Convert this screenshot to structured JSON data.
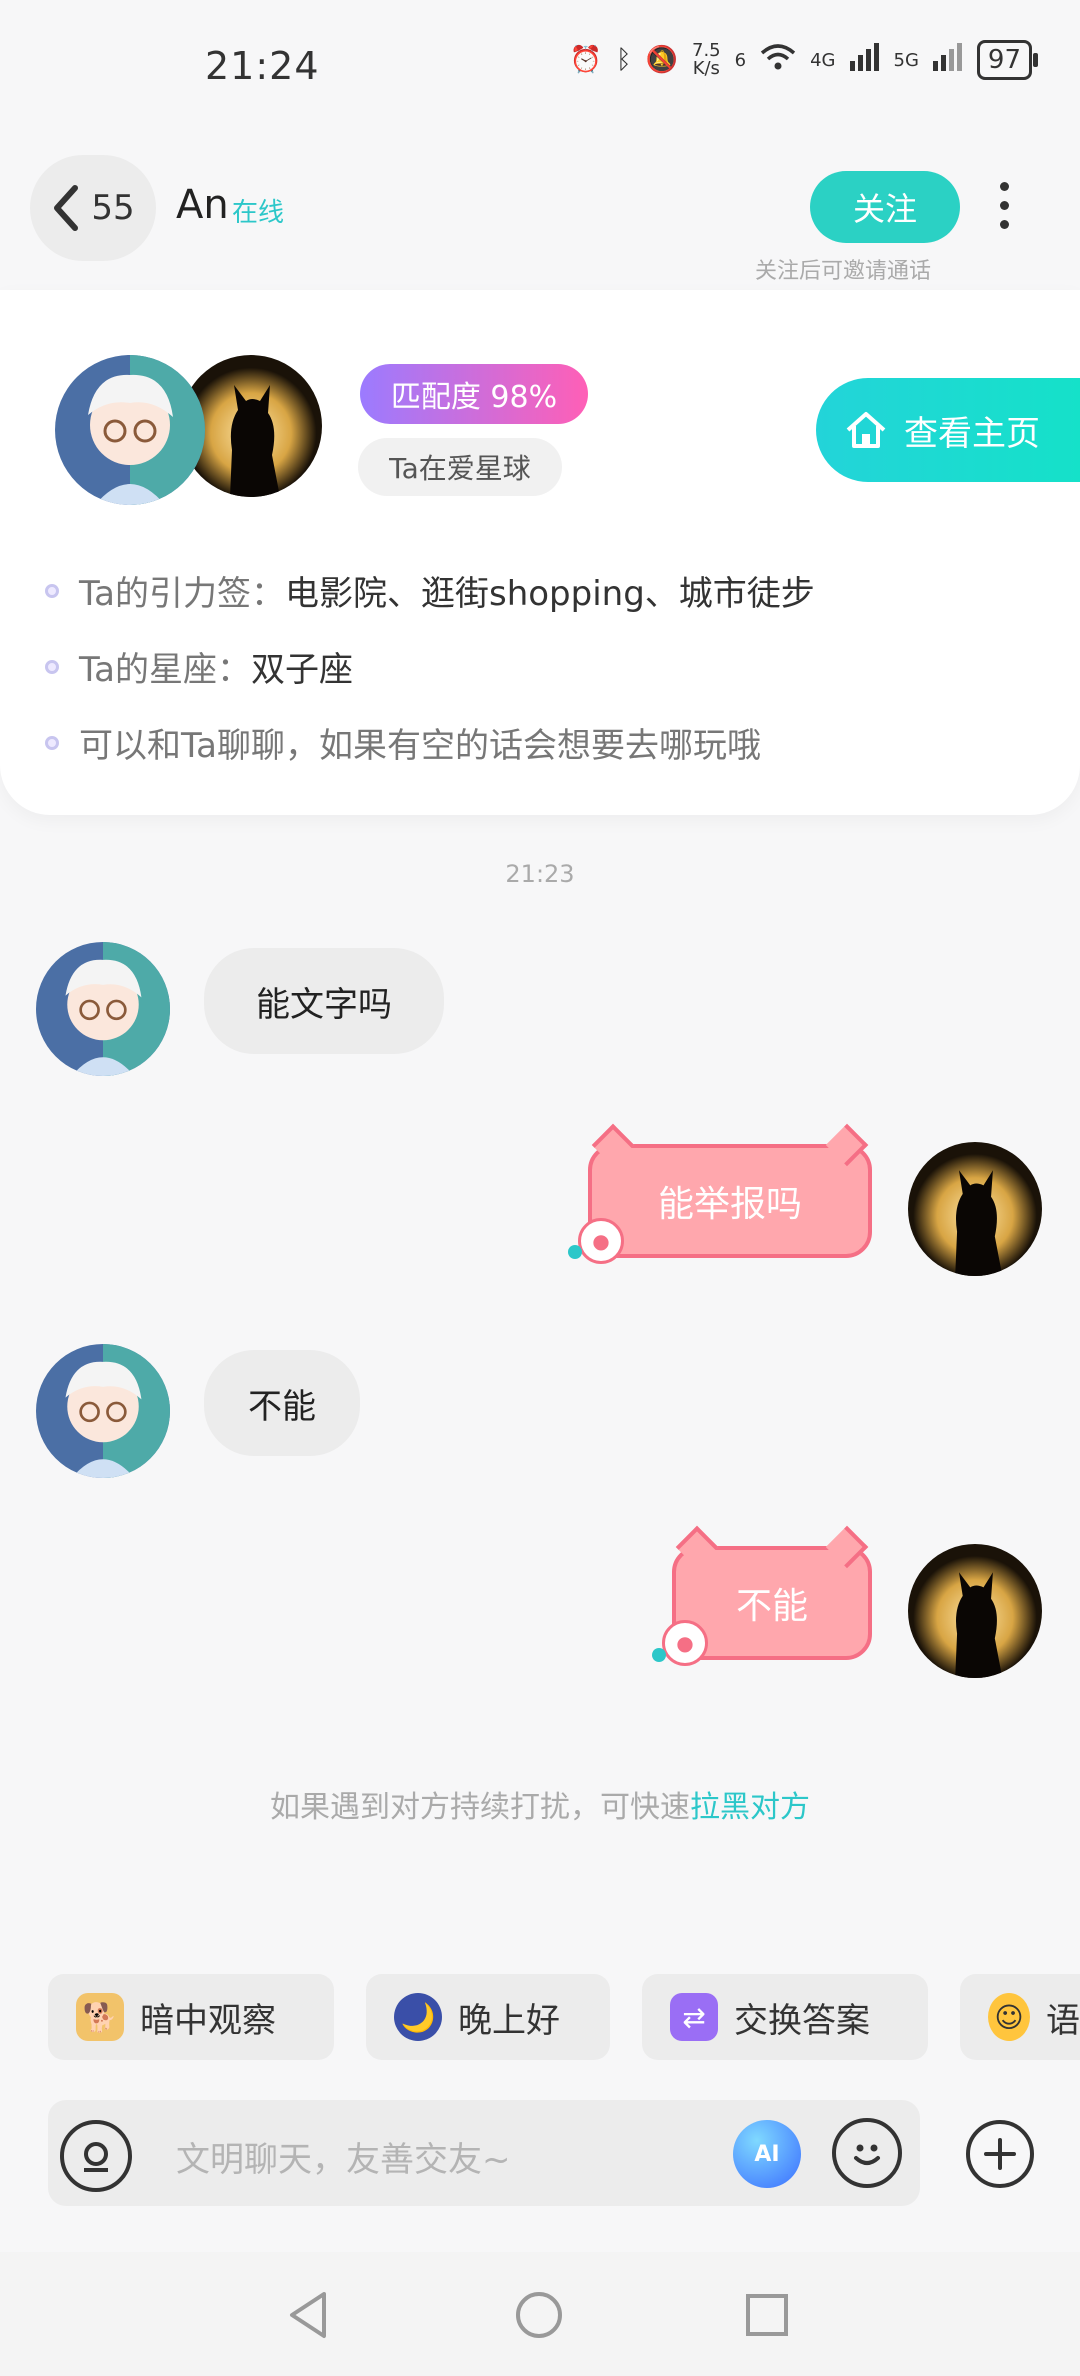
{
  "status_bar": {
    "time": "21:24",
    "net_speed_value": "7.5",
    "net_speed_unit": "K/s",
    "wifi_badge": "6",
    "signal1": "4G",
    "signal2": "5G",
    "battery": "97"
  },
  "header": {
    "back_count": "55",
    "username": "An",
    "online_status": "在线",
    "follow_label": "关注",
    "follow_hint": "关注后可邀请通话"
  },
  "profile": {
    "match_label": "匹配度 98%",
    "planet_tag": "Ta在爱星球",
    "home_button": "查看主页",
    "info": [
      {
        "label": "Ta的引力签：",
        "value": "电影院、逛街shopping、城市徒步"
      },
      {
        "label": "Ta的星座：",
        "value": "双子座"
      },
      {
        "label": "",
        "value": "可以和Ta聊聊，如果有空的话会想要去哪玩哦"
      }
    ]
  },
  "chat": {
    "timestamp": "21:23",
    "messages": [
      {
        "side": "in",
        "text": "能文字吗"
      },
      {
        "side": "out",
        "text": "能举报吗"
      },
      {
        "side": "in",
        "text": "不能"
      },
      {
        "side": "out",
        "text": "不能"
      }
    ],
    "notice_text": "如果遇到对方持续打扰，可快速",
    "notice_link": "拉黑对方"
  },
  "quick_replies": [
    {
      "label": "暗中观察",
      "icon": "shiba-dog-icon"
    },
    {
      "label": "晚上好",
      "icon": "moon-night-icon"
    },
    {
      "label": "交换答案",
      "icon": "exchange-icon"
    },
    {
      "label": "语",
      "icon": "smile-emoji-icon"
    }
  ],
  "input": {
    "placeholder": "文明聊天，友善交友~",
    "ai_label": "AI"
  },
  "colors": {
    "accent": "#2bd1c4",
    "bubble_out": "#ffa7ad",
    "bubble_out_border": "#f56f85"
  }
}
